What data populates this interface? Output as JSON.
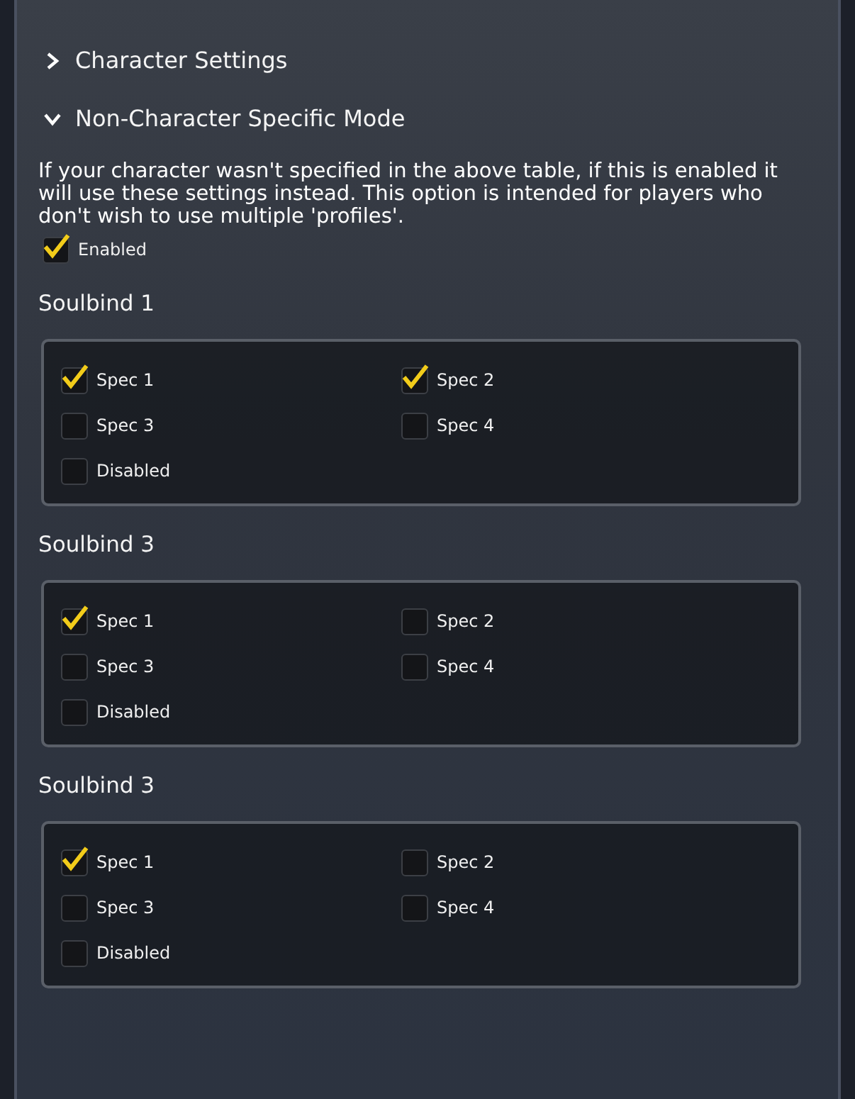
{
  "sections": [
    {
      "label": "Character Settings",
      "expanded": false
    },
    {
      "label": "Non-Character Specific Mode",
      "expanded": true
    }
  ],
  "description": "If your character wasn't specified in the above table, if this is enabled it will use these settings instead. This option is intended for players who don't wish to use multiple 'profiles'.",
  "enabled": {
    "label": "Enabled",
    "checked": true
  },
  "groups": [
    {
      "title": "Soulbind 1",
      "options": [
        {
          "label": "Spec 1",
          "checked": true
        },
        {
          "label": "Spec 2",
          "checked": true
        },
        {
          "label": "Spec 3",
          "checked": false
        },
        {
          "label": "Spec 4",
          "checked": false
        },
        {
          "label": "Disabled",
          "checked": false
        }
      ]
    },
    {
      "title": "Soulbind 3",
      "options": [
        {
          "label": "Spec 1",
          "checked": true
        },
        {
          "label": "Spec 2",
          "checked": false
        },
        {
          "label": "Spec 3",
          "checked": false
        },
        {
          "label": "Spec 4",
          "checked": false
        },
        {
          "label": "Disabled",
          "checked": false
        }
      ]
    },
    {
      "title": "Soulbind 3",
      "options": [
        {
          "label": "Spec 1",
          "checked": true
        },
        {
          "label": "Spec 2",
          "checked": false
        },
        {
          "label": "Spec 3",
          "checked": false
        },
        {
          "label": "Spec 4",
          "checked": false
        },
        {
          "label": "Disabled",
          "checked": false
        }
      ]
    }
  ]
}
